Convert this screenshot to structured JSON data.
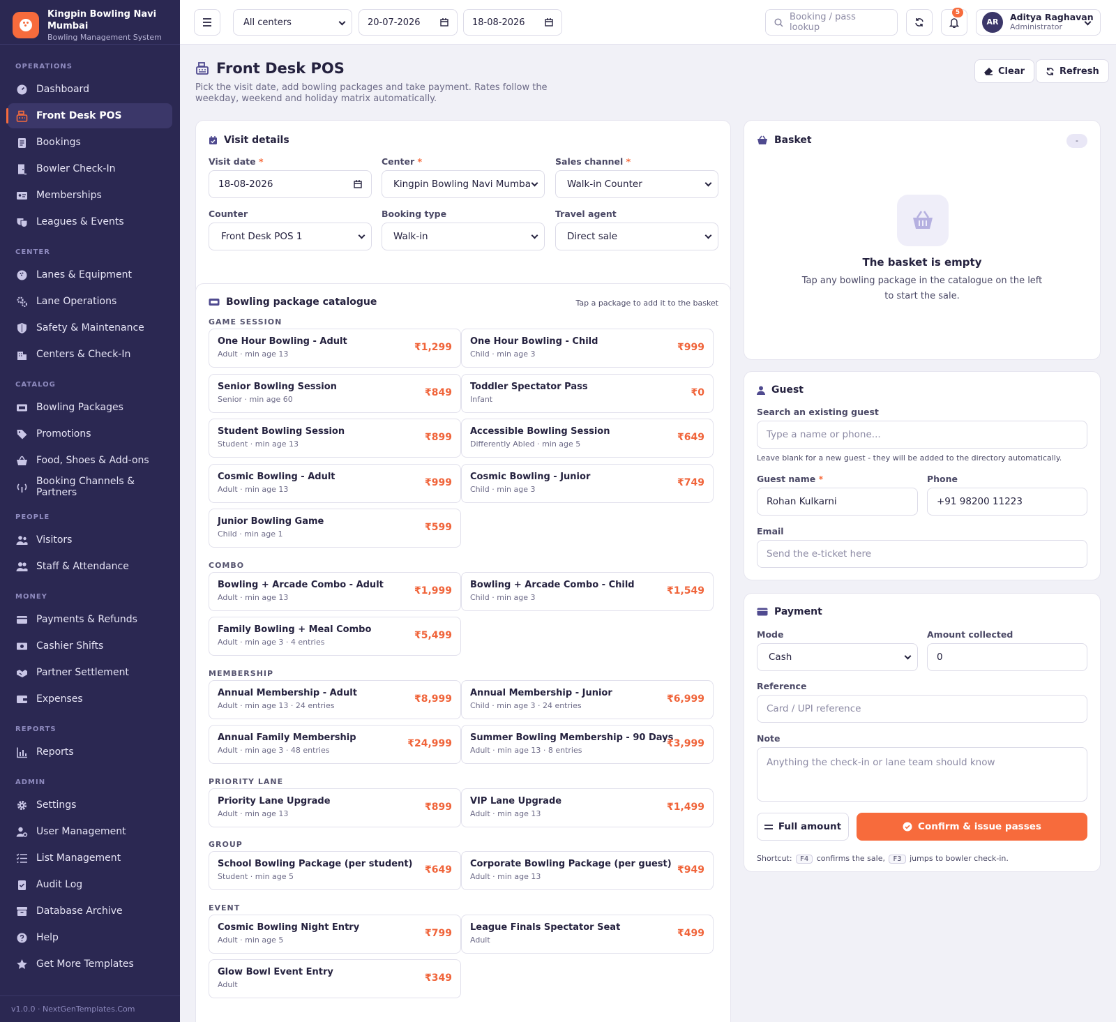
{
  "brand": {
    "name": "Kingpin Bowling Navi Mumbai",
    "subtitle": "Bowling Management System"
  },
  "nav": {
    "operations_title": "OPERATIONS",
    "operations": [
      {
        "label": "Dashboard",
        "icon": "dashboard-icon"
      },
      {
        "label": "Front Desk POS",
        "icon": "cash-register-icon",
        "active": true
      },
      {
        "label": "Bookings",
        "icon": "clipboard-icon"
      },
      {
        "label": "Bowler Check-In",
        "icon": "door-icon"
      },
      {
        "label": "Memberships",
        "icon": "id-card-icon"
      },
      {
        "label": "Leagues & Events",
        "icon": "masks-icon"
      }
    ],
    "center_title": "CENTER",
    "center": [
      {
        "label": "Lanes & Equipment",
        "icon": "bowling-ball-icon"
      },
      {
        "label": "Lane Operations",
        "icon": "gears-icon"
      },
      {
        "label": "Safety & Maintenance",
        "icon": "shield-icon"
      },
      {
        "label": "Centers & Check-In",
        "icon": "building-icon"
      }
    ],
    "catalog_title": "CATALOG",
    "catalog": [
      {
        "label": "Bowling Packages",
        "icon": "ticket-icon"
      },
      {
        "label": "Promotions",
        "icon": "tags-icon"
      },
      {
        "label": "Food, Shoes & Add-ons",
        "icon": "basket-icon"
      },
      {
        "label": "Booking Channels & Partners",
        "icon": "broadcast-icon"
      }
    ],
    "people_title": "PEOPLE",
    "people": [
      {
        "label": "Visitors",
        "icon": "users-icon"
      },
      {
        "label": "Staff & Attendance",
        "icon": "user-group-icon"
      }
    ],
    "money_title": "MONEY",
    "money": [
      {
        "label": "Payments & Refunds",
        "icon": "credit-card-icon"
      },
      {
        "label": "Cashier Shifts",
        "icon": "cash-icon"
      },
      {
        "label": "Partner Settlement",
        "icon": "handshake-icon"
      },
      {
        "label": "Expenses",
        "icon": "wallet-icon"
      }
    ],
    "reports_title": "REPORTS",
    "reports": [
      {
        "label": "Reports",
        "icon": "bar-chart-icon"
      }
    ],
    "admin_title": "ADMIN",
    "admin": [
      {
        "label": "Settings",
        "icon": "gear-icon"
      },
      {
        "label": "User Management",
        "icon": "user-cog-icon"
      },
      {
        "label": "List Management",
        "icon": "list-icon"
      },
      {
        "label": "Audit Log",
        "icon": "clipboard-check-icon"
      },
      {
        "label": "Database Archive",
        "icon": "archive-icon"
      },
      {
        "label": "Help",
        "icon": "help-icon"
      },
      {
        "label": "Get More Templates",
        "icon": "star-icon"
      }
    ]
  },
  "footer": "v1.0.0 · NextGenTemplates.Com",
  "topbar": {
    "center_select": "All centers",
    "date_from": "20-07-2026",
    "date_to": "18-08-2026",
    "lookup_placeholder": "Booking / pass lookup",
    "notif_count": "5",
    "user_initials": "AR",
    "user_name": "Aditya Raghavan",
    "user_role": "Administrator"
  },
  "page": {
    "title": "Front Desk POS",
    "description": "Pick the visit date, add bowling packages and take payment. Rates follow the weekday, weekend and holiday matrix automatically.",
    "clear_label": "Clear",
    "refresh_label": "Refresh"
  },
  "visit": {
    "title": "Visit details",
    "visit_date_label": "Visit date",
    "visit_date": "18-08-2026",
    "center_label": "Center",
    "center": "Kingpin Bowling Navi Mumbai",
    "channel_label": "Sales channel",
    "channel": "Walk-in Counter",
    "counter_label": "Counter",
    "counter": "Front Desk POS 1",
    "booking_type_label": "Booking type",
    "booking_type": "Walk-in",
    "agent_label": "Travel agent",
    "agent": "Direct sale",
    "required_mark": "*"
  },
  "catalogue": {
    "title": "Bowling package catalogue",
    "hint": "Tap a package to add it to the basket",
    "sections": [
      {
        "title": "GAME SESSION",
        "items": [
          {
            "name": "One Hour Bowling - Adult",
            "meta": "Adult · min age 13",
            "price": "₹1,299"
          },
          {
            "name": "One Hour Bowling - Child",
            "meta": "Child · min age 3",
            "price": "₹999"
          },
          {
            "name": "Senior Bowling Session",
            "meta": "Senior · min age 60",
            "price": "₹849"
          },
          {
            "name": "Toddler Spectator Pass",
            "meta": "Infant",
            "price": "₹0"
          },
          {
            "name": "Student Bowling Session",
            "meta": "Student · min age 13",
            "price": "₹899"
          },
          {
            "name": "Accessible Bowling Session",
            "meta": "Differently Abled · min age 5",
            "price": "₹649"
          },
          {
            "name": "Cosmic Bowling - Adult",
            "meta": "Adult · min age 13",
            "price": "₹999"
          },
          {
            "name": "Cosmic Bowling - Junior",
            "meta": "Child · min age 3",
            "price": "₹749"
          },
          {
            "name": "Junior Bowling Game",
            "meta": "Child · min age 1",
            "price": "₹599"
          }
        ]
      },
      {
        "title": "COMBO",
        "items": [
          {
            "name": "Bowling + Arcade Combo - Adult",
            "meta": "Adult · min age 13",
            "price": "₹1,999"
          },
          {
            "name": "Bowling + Arcade Combo - Child",
            "meta": "Child · min age 3",
            "price": "₹1,549"
          },
          {
            "name": "Family Bowling + Meal Combo",
            "meta": "Adult · min age 3 · 4 entries",
            "price": "₹5,499"
          }
        ]
      },
      {
        "title": "MEMBERSHIP",
        "items": [
          {
            "name": "Annual Membership - Adult",
            "meta": "Adult · min age 13 · 24 entries",
            "price": "₹8,999"
          },
          {
            "name": "Annual Membership - Junior",
            "meta": "Child · min age 3 · 24 entries",
            "price": "₹6,999"
          },
          {
            "name": "Annual Family Membership",
            "meta": "Adult · min age 3 · 48 entries",
            "price": "₹24,999"
          },
          {
            "name": "Summer Bowling Membership - 90 Days",
            "meta": "Adult · min age 13 · 8 entries",
            "price": "₹3,999"
          }
        ]
      },
      {
        "title": "PRIORITY LANE",
        "items": [
          {
            "name": "Priority Lane Upgrade",
            "meta": "Adult · min age 13",
            "price": "₹899"
          },
          {
            "name": "VIP Lane Upgrade",
            "meta": "Adult · min age 13",
            "price": "₹1,499"
          }
        ]
      },
      {
        "title": "GROUP",
        "items": [
          {
            "name": "School Bowling Package (per student)",
            "meta": "Student · min age 5",
            "price": "₹649"
          },
          {
            "name": "Corporate Bowling Package (per guest)",
            "meta": "Adult · min age 13",
            "price": "₹949"
          }
        ]
      },
      {
        "title": "EVENT",
        "items": [
          {
            "name": "Cosmic Bowling Night Entry",
            "meta": "Adult · min age 5",
            "price": "₹799"
          },
          {
            "name": "League Finals Spectator Seat",
            "meta": "Adult",
            "price": "₹499"
          },
          {
            "name": "Glow Bowl Event Entry",
            "meta": "Adult",
            "price": "₹349"
          }
        ]
      }
    ]
  },
  "basket": {
    "title": "Basket",
    "badge": "-",
    "empty_title": "The basket is empty",
    "empty_text": "Tap any bowling package in the catalogue on the left to start the sale."
  },
  "guest": {
    "title": "Guest",
    "search_label": "Search an existing guest",
    "search_placeholder": "Type a name or phone...",
    "search_help": "Leave blank for a new guest - they will be added to the directory automatically.",
    "name_label": "Guest name",
    "name": "Rohan Kulkarni",
    "phone_label": "Phone",
    "phone": "+91 98200 11223",
    "email_label": "Email",
    "email_placeholder": "Send the e-ticket here"
  },
  "payment": {
    "title": "Payment",
    "mode_label": "Mode",
    "mode": "Cash",
    "amount_label": "Amount collected",
    "amount": "0",
    "reference_label": "Reference",
    "reference_placeholder": "Card / UPI reference",
    "note_label": "Note",
    "note_placeholder": "Anything the check-in or lane team should know",
    "full_amount_label": "Full amount",
    "confirm_label": "Confirm & issue passes",
    "shortcut_pre": "Shortcut:",
    "key1": "F4",
    "shortcut_mid": "confirms the sale,",
    "key2": "F3",
    "shortcut_post": "jumps to bowler check-in."
  },
  "colors": {
    "accent": "#f76b3c",
    "sidebar": "#2b2852",
    "primary": "#4f4a8f"
  }
}
